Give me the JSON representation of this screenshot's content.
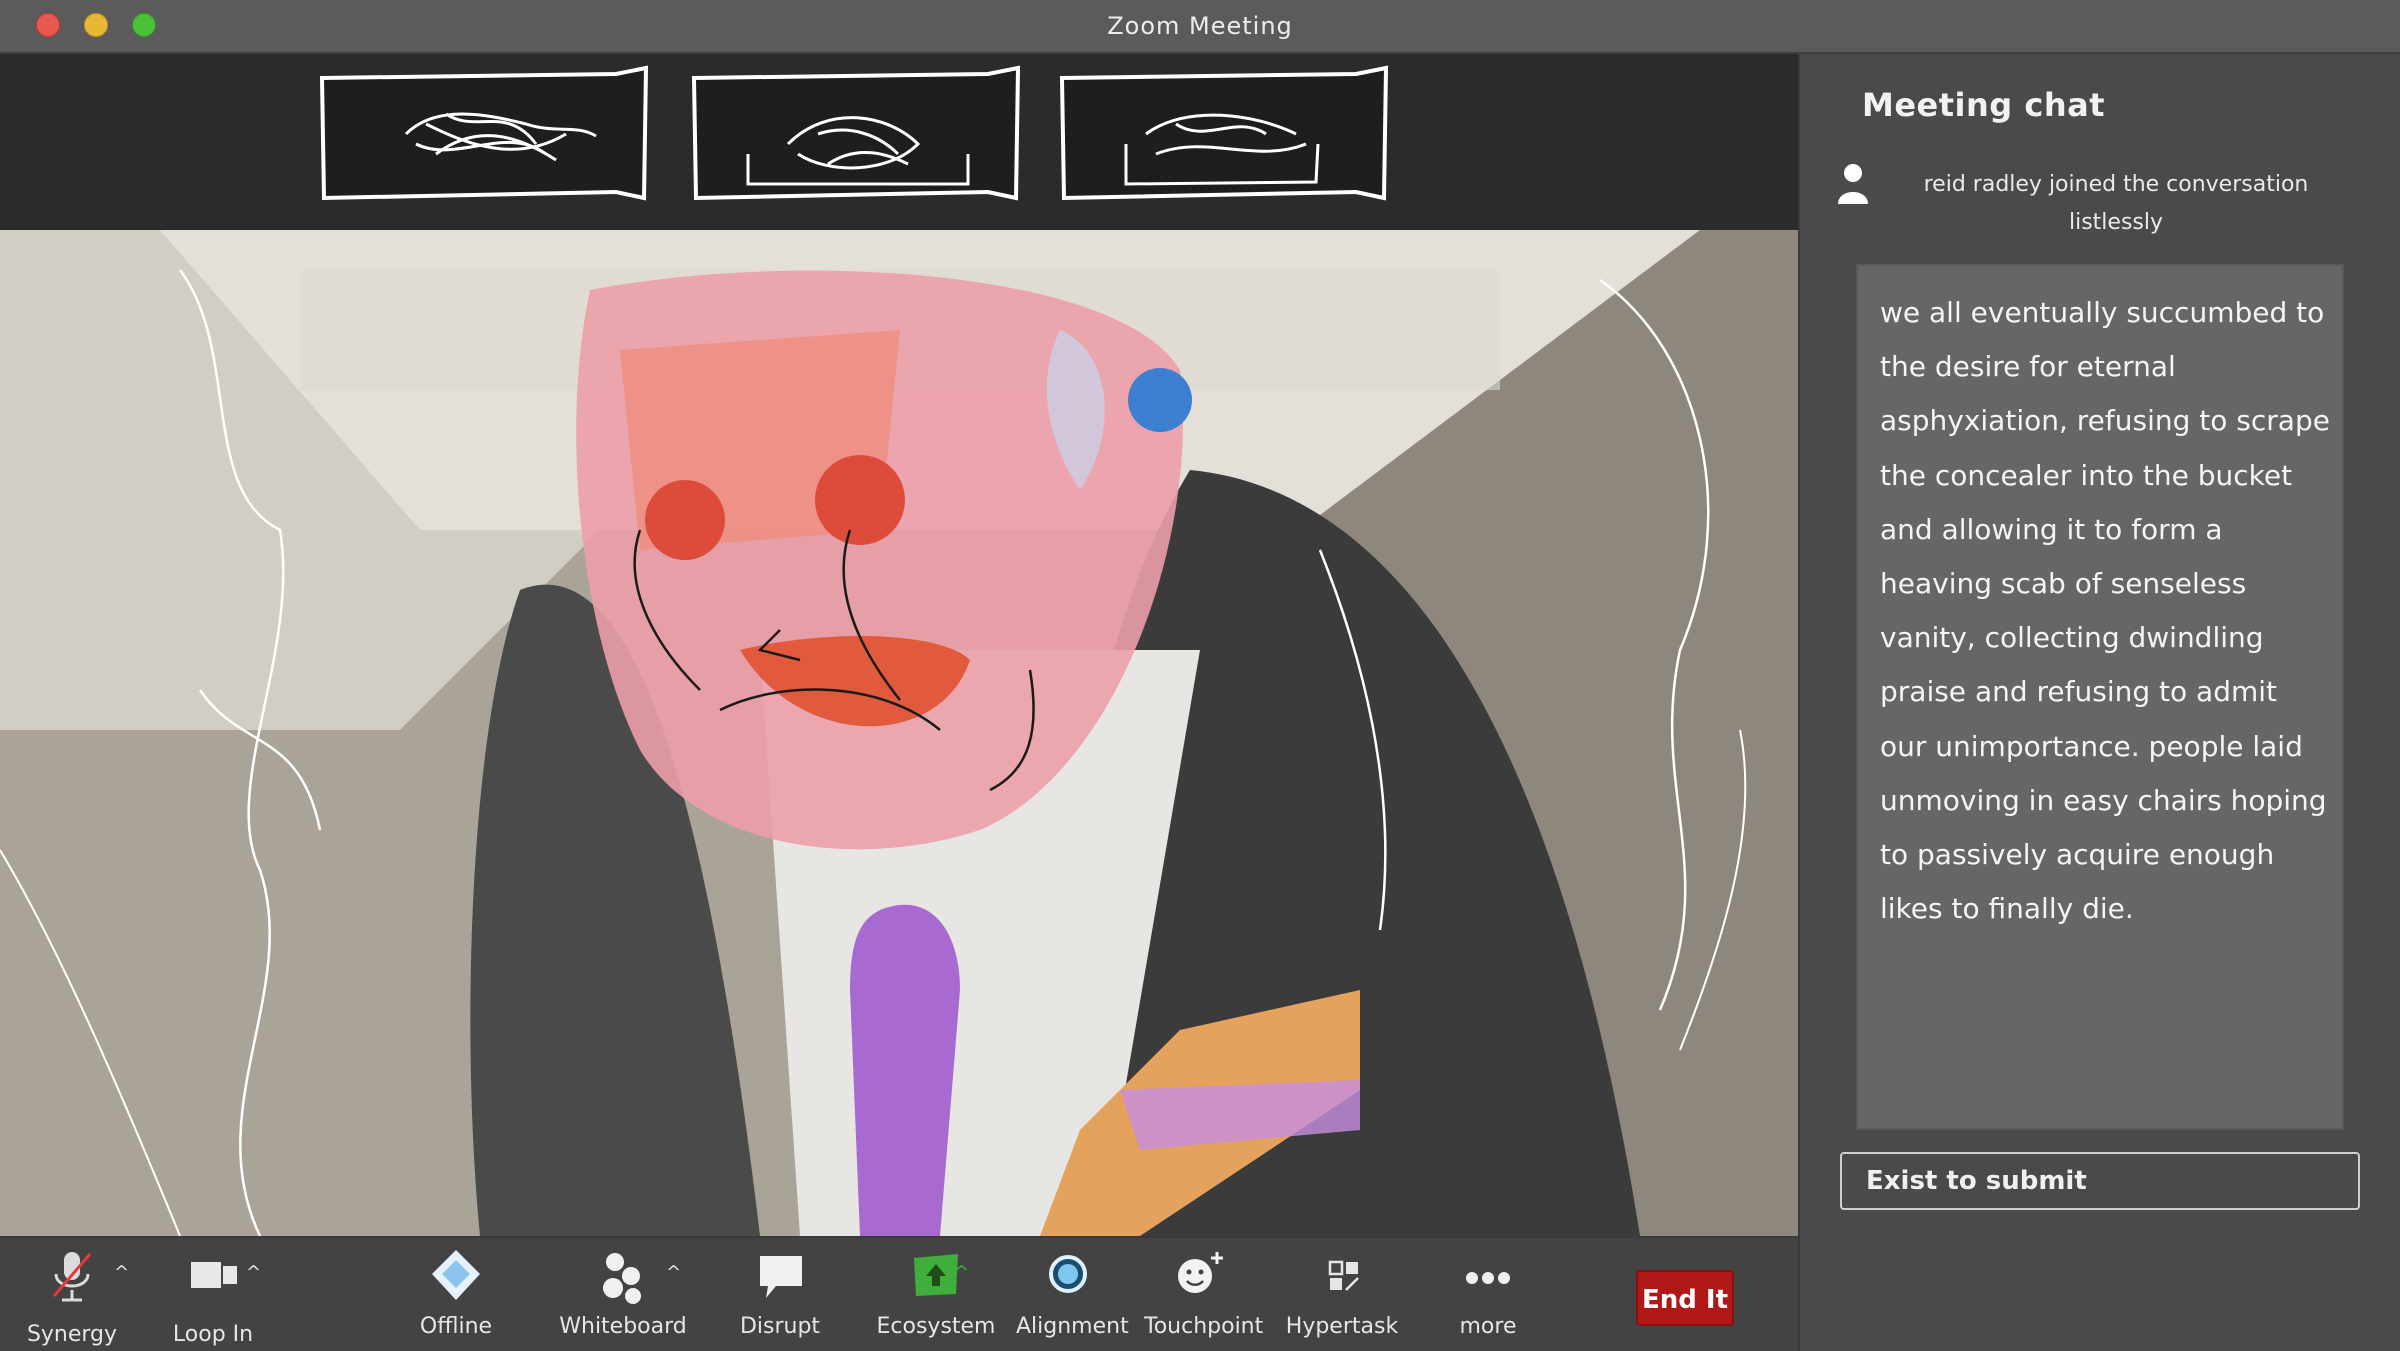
{
  "window": {
    "title": "Zoom Meeting"
  },
  "chat": {
    "title": "Meeting chat",
    "join_message": "reid radley joined the conversation listlessly",
    "message": "we all eventually succumbed to the desire for eternal asphyxiation, refusing to scrape the concealer into the bucket and allowing it to form a heaving scab of senseless vanity, collecting dwindling praise and refusing to admit our unimportance. people laid unmoving in easy chairs hoping to passively acquire enough likes to finally die.",
    "submit_label": "Exist to submit"
  },
  "toolbar": {
    "items": [
      {
        "label": "Synergy",
        "icon": "muted-microphone-icon"
      },
      {
        "label": "Loop In",
        "icon": "video-camera-icon"
      },
      {
        "label": "Offline",
        "icon": "shield-icon"
      },
      {
        "label": "Whiteboard",
        "icon": "participants-icon"
      },
      {
        "label": "Disrupt",
        "icon": "chat-bubble-icon"
      },
      {
        "label": "Ecosystem",
        "icon": "share-screen-icon"
      },
      {
        "label": "Alignment",
        "icon": "record-icon"
      },
      {
        "label": "Touchpoint",
        "icon": "reactions-icon"
      },
      {
        "label": "Hypertask",
        "icon": "apps-icon"
      },
      {
        "label": "more",
        "icon": "more-dots-icon"
      }
    ],
    "end_label": "End It"
  },
  "colors": {
    "end_button": "#b01818",
    "share_green": "#3fae3a",
    "titlebar": "#5b5b5b"
  }
}
